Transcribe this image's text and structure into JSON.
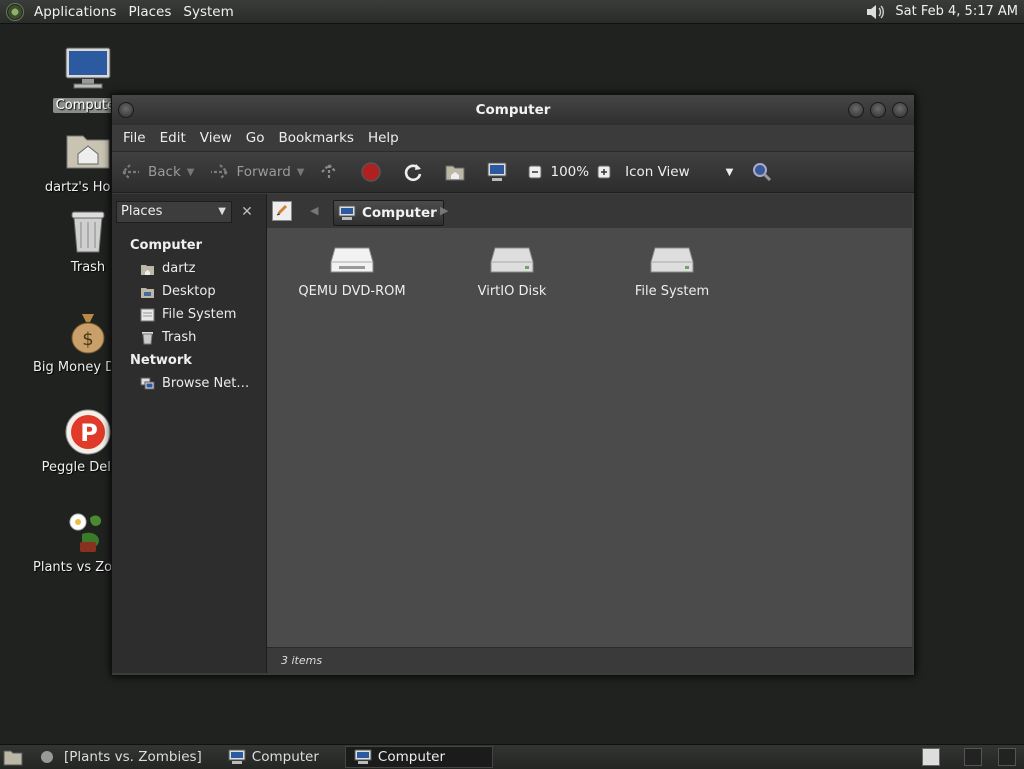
{
  "top_panel": {
    "menus": [
      "Applications",
      "Places",
      "System"
    ],
    "clock": "Sat Feb  4,  5:17 AM"
  },
  "desktop": {
    "icons": [
      {
        "label": "Computer",
        "icon": "computer-icon",
        "selected": true
      },
      {
        "label": "dartz's Home",
        "icon": "home-folder-icon"
      },
      {
        "label": "Trash",
        "icon": "trash-icon"
      },
      {
        "label": "Big Money Deluxe",
        "icon": "money-bag-icon"
      },
      {
        "label": "Peggle Deluxe",
        "icon": "peggle-icon"
      },
      {
        "label": "Plants vs Zombies",
        "icon": "plants-icon"
      }
    ]
  },
  "window": {
    "title": "Computer",
    "menu": [
      "File",
      "Edit",
      "View",
      "Go",
      "Bookmarks",
      "Help"
    ],
    "toolbar": {
      "back": "Back",
      "forward": "Forward",
      "zoom": "100%",
      "view_mode": "Icon View"
    },
    "sidebar": {
      "combo": "Places",
      "sections": [
        {
          "heading": "Computer",
          "items": [
            {
              "label": "dartz",
              "icon": "home-icon"
            },
            {
              "label": "Desktop",
              "icon": "desktop-icon"
            },
            {
              "label": "File System",
              "icon": "filesystem-icon"
            },
            {
              "label": "Trash",
              "icon": "trash-icon"
            }
          ]
        },
        {
          "heading": "Network",
          "items": [
            {
              "label": "Browse Net…",
              "icon": "network-icon"
            }
          ]
        }
      ]
    },
    "location": {
      "crumb": "Computer"
    },
    "files": [
      {
        "label": "QEMU DVD-ROM",
        "icon": "optical-drive-icon"
      },
      {
        "label": "VirtIO Disk",
        "icon": "hard-disk-icon"
      },
      {
        "label": "File System",
        "icon": "hard-disk-icon"
      }
    ],
    "status": "3 items"
  },
  "bottom_panel": {
    "tasks": [
      {
        "label": "[Plants vs. Zombies]",
        "active": false
      },
      {
        "label": "Computer",
        "active": false
      },
      {
        "label": "Computer",
        "active": true
      }
    ]
  }
}
